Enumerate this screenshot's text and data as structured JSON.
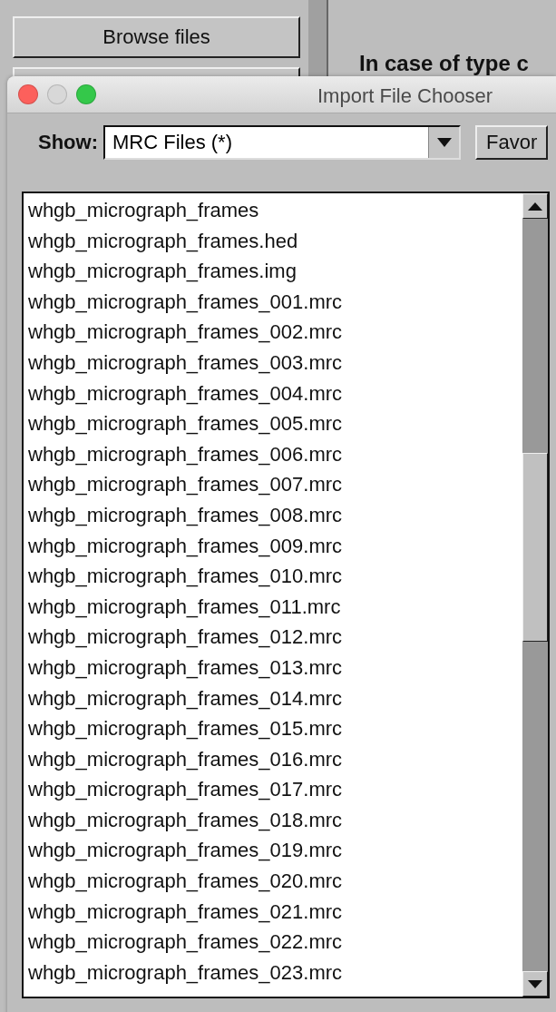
{
  "background": {
    "browse_button": "Browse files",
    "heading": "In case of type c"
  },
  "dialog": {
    "title": "Import File Chooser",
    "show_label": "Show:",
    "filter": "MRC Files (*)",
    "favorites_button": "Favor",
    "files": [
      {
        "name": "whgb_micrograph_frames"
      },
      {
        "name": "whgb_micrograph_frames.hed"
      },
      {
        "name": "whgb_micrograph_frames.img"
      },
      {
        "name": "whgb_micrograph_frames_001.mrc"
      },
      {
        "name": "whgb_micrograph_frames_002.mrc"
      },
      {
        "name": "whgb_micrograph_frames_003.mrc"
      },
      {
        "name": "whgb_micrograph_frames_004.mrc"
      },
      {
        "name": "whgb_micrograph_frames_005.mrc"
      },
      {
        "name": "whgb_micrograph_frames_006.mrc"
      },
      {
        "name": "whgb_micrograph_frames_007.mrc"
      },
      {
        "name": "whgb_micrograph_frames_008.mrc"
      },
      {
        "name": "whgb_micrograph_frames_009.mrc"
      },
      {
        "name": "whgb_micrograph_frames_010.mrc"
      },
      {
        "name": "whgb_micrograph_frames_011.mrc"
      },
      {
        "name": "whgb_micrograph_frames_012.mrc"
      },
      {
        "name": "whgb_micrograph_frames_013.mrc"
      },
      {
        "name": "whgb_micrograph_frames_014.mrc"
      },
      {
        "name": "whgb_micrograph_frames_015.mrc"
      },
      {
        "name": "whgb_micrograph_frames_016.mrc"
      },
      {
        "name": "whgb_micrograph_frames_017.mrc"
      },
      {
        "name": "whgb_micrograph_frames_018.mrc"
      },
      {
        "name": "whgb_micrograph_frames_019.mrc"
      },
      {
        "name": "whgb_micrograph_frames_020.mrc"
      },
      {
        "name": "whgb_micrograph_frames_021.mrc"
      },
      {
        "name": "whgb_micrograph_frames_022.mrc"
      },
      {
        "name": "whgb_micrograph_frames_023.mrc"
      }
    ]
  }
}
